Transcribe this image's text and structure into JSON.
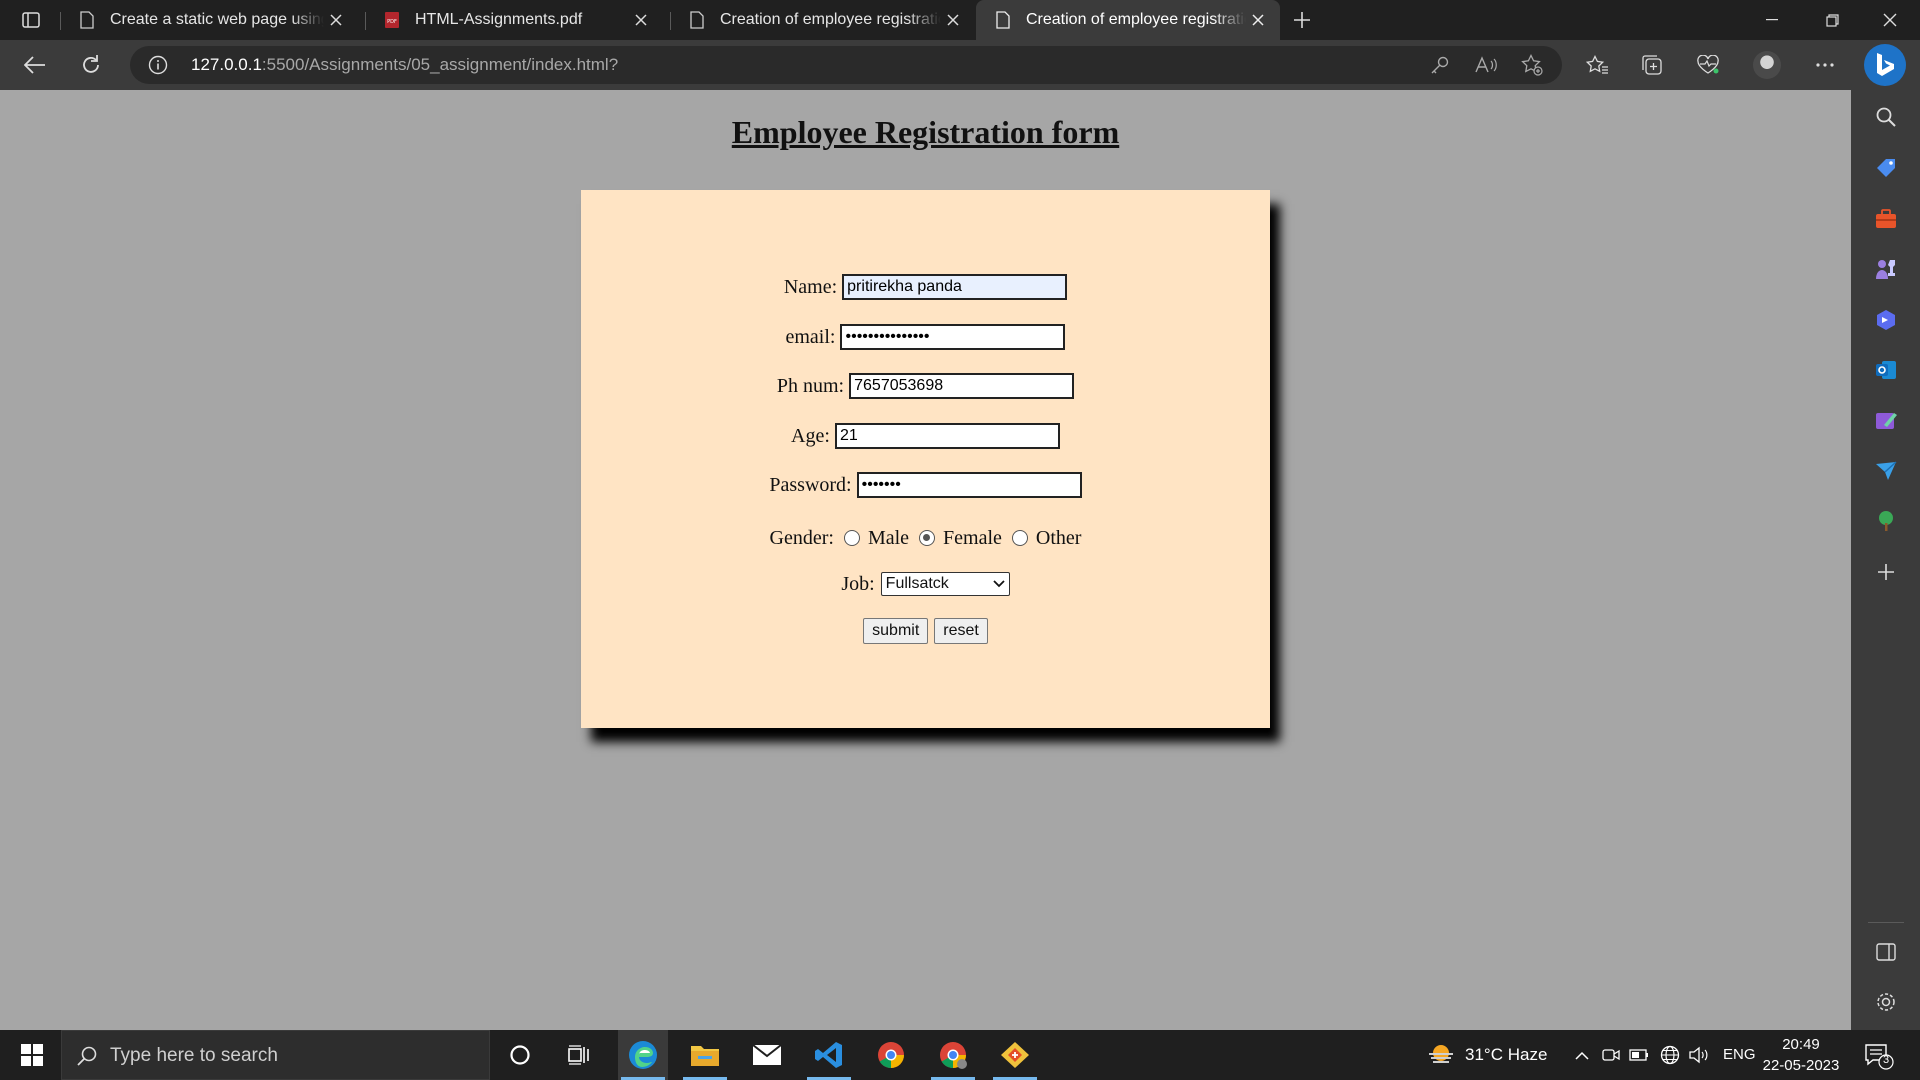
{
  "browser": {
    "tabs": [
      {
        "title": "Create a static web page using ta",
        "icon": "page-icon",
        "active": false
      },
      {
        "title": "HTML-Assignments.pdf",
        "icon": "pdf-icon",
        "active": false
      },
      {
        "title": "Creation of employee registratio",
        "icon": "page-icon",
        "active": false
      },
      {
        "title": "Creation of employee registratio",
        "icon": "page-icon",
        "active": true
      }
    ],
    "url_host": "127.0.0.1",
    "url_rest": ":5500/Assignments/05_assignment/index.html?"
  },
  "page": {
    "title": "Employee Registration form",
    "form": {
      "name_label": "Name:",
      "name_value": "pritirekha panda",
      "email_label": "email:",
      "email_value": "•••••••••••••••",
      "phone_label": "Ph num:",
      "phone_value": "7657053698",
      "age_label": "Age:",
      "age_value": "21",
      "password_label": "Password:",
      "password_value": "•••••••",
      "gender_label": "Gender:",
      "gender_options": [
        "Male",
        "Female",
        "Other"
      ],
      "gender_selected": "Female",
      "job_label": "Job:",
      "job_selected": "Fullsatck",
      "submit_label": "submit",
      "reset_label": "reset"
    }
  },
  "taskbar": {
    "search_placeholder": "Type here to search",
    "weather": "31°C  Haze",
    "language": "ENG",
    "time": "20:49",
    "date": "22-05-2023",
    "notification_count": "3"
  },
  "colors": {
    "page_bg": "#a6a6a6",
    "form_bg": "#ffe4c4",
    "browser_chrome": "#3b3b3b",
    "tab_strip": "#202020"
  }
}
